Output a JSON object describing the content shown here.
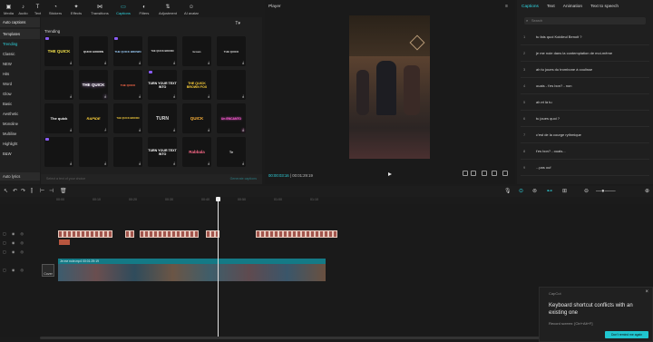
{
  "toolbar": {
    "items": [
      "Media",
      "Audio",
      "Text",
      "Stickers",
      "Effects",
      "Transitions",
      "Captions",
      "Filters",
      "Adjustment",
      "AI avatar"
    ],
    "active": "Captions"
  },
  "left_panel": {
    "header": "Auto captions",
    "templates": "Templates",
    "categories": [
      "Trending",
      "Classic",
      "NEW",
      "Hits",
      "Word",
      "Glow",
      "Basic",
      "Aesthetic",
      "Monoline",
      "Multiline",
      "Highlight",
      "B&W"
    ],
    "auto_lyrics": "Auto lyrics",
    "section_label": "Trending",
    "tile_texts": [
      "THE QUICK",
      "QUICK BROWN",
      "THE QUICK BROWN",
      "THE QUICK BROWN",
      "brown",
      "THE QUICK",
      "",
      "THE QUICK",
      "THE QUICK",
      "TURN YOUR TEXT INTO",
      "THE QUICK BROWN FOX",
      "",
      "The quick",
      "RAPIDE",
      "THE QUICK BROWN",
      "TURN",
      "QUICK",
      "Un ENCANTO",
      "",
      "",
      "",
      "TURN YOUR TEXT INTO",
      "Rabbala",
      "Te"
    ],
    "footer_left": "Select a text of your choice",
    "footer_right": "Generate captions"
  },
  "player": {
    "title": "Player",
    "current_time": "00:00:03:16",
    "total_time": "00:01:29:19"
  },
  "right_panel": {
    "tabs": [
      "Captions",
      "Text",
      "Animation",
      "Text to speech"
    ],
    "search_placeholder": "Search",
    "captions": [
      "tu fais quoi Koidieul Benoit ?",
      "je me noie dans la contemplation de moi-même",
      "ah tu joues du trombone à coulisse",
      "ouais - t'es bon? - non",
      "ah et là tu",
      "tu joues quoi ?",
      "c'est de la courge rythmique",
      "t'es bon? - ouais...",
      "...pas ouf"
    ]
  },
  "timeline": {
    "ruler": [
      "00:00",
      "00:10",
      "00:20",
      "00:30",
      "00:40",
      "00:50",
      "01:00",
      "01:10"
    ],
    "video_label": "Je me noie.mp4  00:01:29:19",
    "cover_label": "Cover"
  },
  "toast": {
    "app_name": "CapCut",
    "message": "Keyboard shortcut conflicts with an existing one",
    "hint": "Record screen: [Ctrl+Alt+F]",
    "button": "Don't remind me again"
  }
}
